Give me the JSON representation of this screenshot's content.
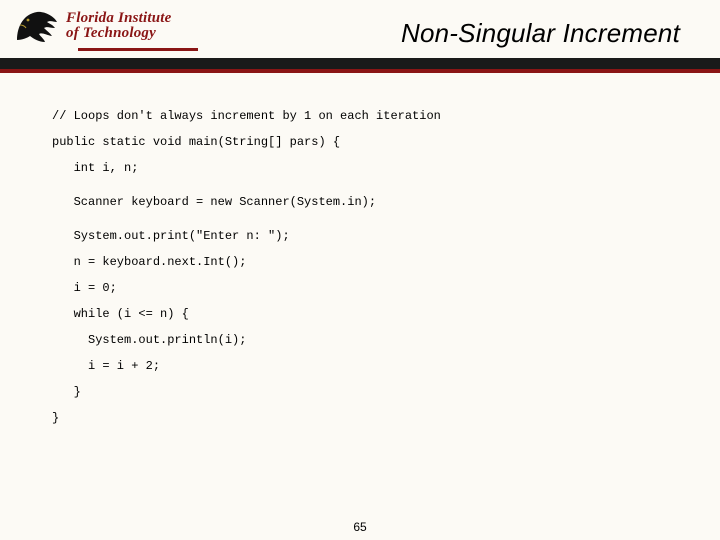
{
  "logo": {
    "line1": "Florida Institute",
    "line2": "of Technology"
  },
  "title": "Non-Singular Increment",
  "code": {
    "l01": "// Loops don't always increment by 1 on each iteration",
    "l02": "public static void main(String[] pars) {",
    "l03": "   int i, n;",
    "l04": "   Scanner keyboard = new Scanner(System.in);",
    "l05": "   System.out.print(\"Enter n: \");",
    "l06": "   n = keyboard.next.Int();",
    "l07": "   i = 0;",
    "l08": "   while (i <= n) {",
    "l09": "     System.out.println(i);",
    "l10": "     i = i + 2;",
    "l11": "   }",
    "l12": "}"
  },
  "page_number": "65"
}
